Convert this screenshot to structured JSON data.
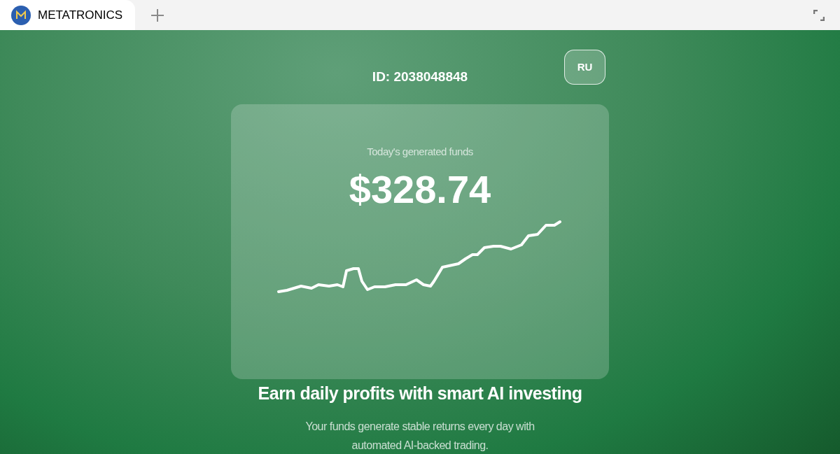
{
  "browser_tab": {
    "title": "METATRONICS"
  },
  "header": {
    "user_id": "ID: 2038048848",
    "language_button": "RU"
  },
  "balance_card": {
    "label": "Today's generated funds",
    "amount": "$328.74"
  },
  "headline": "Earn daily profits with smart AI investing",
  "subtitle_lines": [
    "Your funds generate stable returns every day with",
    "automated AI-backed trading."
  ]
}
